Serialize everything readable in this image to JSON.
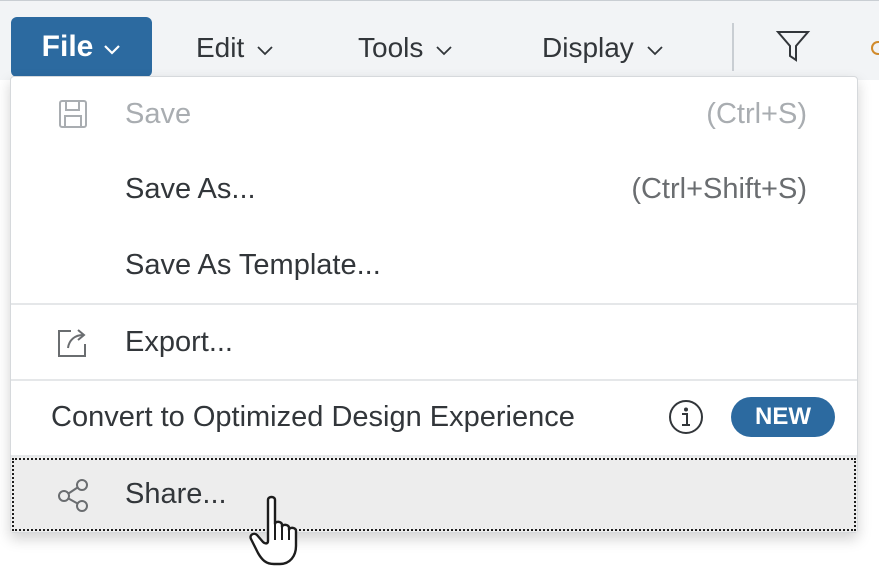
{
  "toolbar": {
    "file_label": "File",
    "edit_label": "Edit",
    "tools_label": "Tools",
    "display_label": "Display",
    "filter_icon": "filter-icon",
    "active_color": "#2c6aa0"
  },
  "menu": {
    "save": {
      "label": "Save",
      "shortcut": "(Ctrl+S)",
      "icon": "save-icon",
      "disabled": true
    },
    "save_as": {
      "label": "Save As...",
      "shortcut": "(Ctrl+Shift+S)"
    },
    "save_as_template": {
      "label": "Save As Template..."
    },
    "export": {
      "label": "Export...",
      "icon": "export-icon"
    },
    "convert": {
      "label": "Convert to Optimized Design Experience",
      "info_icon": "info-icon",
      "badge": "NEW"
    },
    "share": {
      "label": "Share...",
      "icon": "share-icon",
      "hovered": true
    }
  }
}
